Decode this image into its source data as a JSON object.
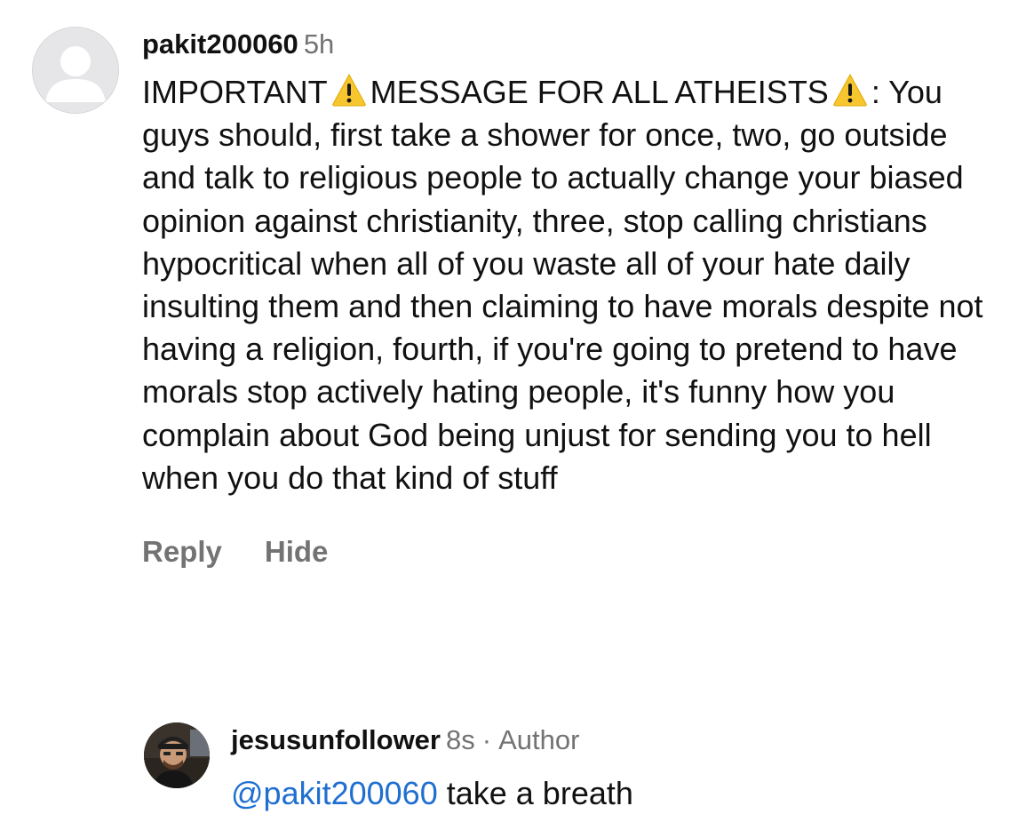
{
  "comments": [
    {
      "username": "pakit200060",
      "time": "5h",
      "text_part1": "IMPORTANT",
      "text_part2": "MESSAGE FOR ALL ATHEISTS",
      "text_part3": ": You guys should, first take a shower for once, two, go outside and talk to religious people to actually change your biased opinion against christianity, three, stop calling christians hypocritical when all of you waste all of your hate daily insulting them and then claiming to have morals despite not having a religion, fourth, if you're going to pretend to have morals stop actively hating people, it's funny how you complain about God being unjust for sending you to hell when you do that kind of stuff",
      "icons": [
        "warning-icon"
      ],
      "actions": {
        "reply": "Reply",
        "hide": "Hide"
      }
    },
    {
      "username": "jesusunfollower",
      "time": "8s",
      "separator": "·",
      "author_tag": "Author",
      "mention": "@pakit200060",
      "text": "take a breath"
    }
  ],
  "colors": {
    "mention": "#1f6fd1",
    "secondary_text": "#737373",
    "warning": "#f7c62f"
  }
}
